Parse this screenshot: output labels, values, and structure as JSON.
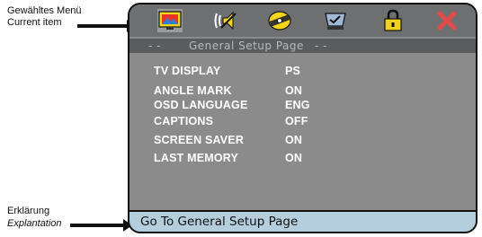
{
  "annotations": {
    "current_item_de": "Gewähltes Menü",
    "current_item_en": "Current item",
    "explanation_de": "Erklärung",
    "explanation_en": "Explantation"
  },
  "iconbar": {
    "icons": [
      "tv-display-icon",
      "audio-speaker-icon",
      "disc-film-icon",
      "monitor-check-icon",
      "padlock-icon",
      "close-x-icon"
    ],
    "selected": "tv-display-icon"
  },
  "page": {
    "title_dashes_left": "- -",
    "title": "General Setup Page",
    "title_dashes_right": "- -"
  },
  "menu": {
    "items": [
      {
        "label": "TV DISPLAY",
        "value": "PS"
      },
      {
        "label": "ANGLE MARK",
        "value": "ON"
      },
      {
        "label": "OSD LANGUAGE",
        "value": "ENG"
      },
      {
        "label": "CAPTIONS",
        "value": "OFF"
      },
      {
        "label": "SCREEN SAVER",
        "value": "ON"
      },
      {
        "label": "LAST MEMORY",
        "value": "ON"
      }
    ]
  },
  "explanation": {
    "text": "Go To General Setup Page"
  },
  "colors": {
    "panel": "#8b8b8b",
    "iconbar": "#6d6f70",
    "explanation_bg": "#b5cedd",
    "close_red": "#e04b4b",
    "lock_yellow": "#f2d21c"
  }
}
